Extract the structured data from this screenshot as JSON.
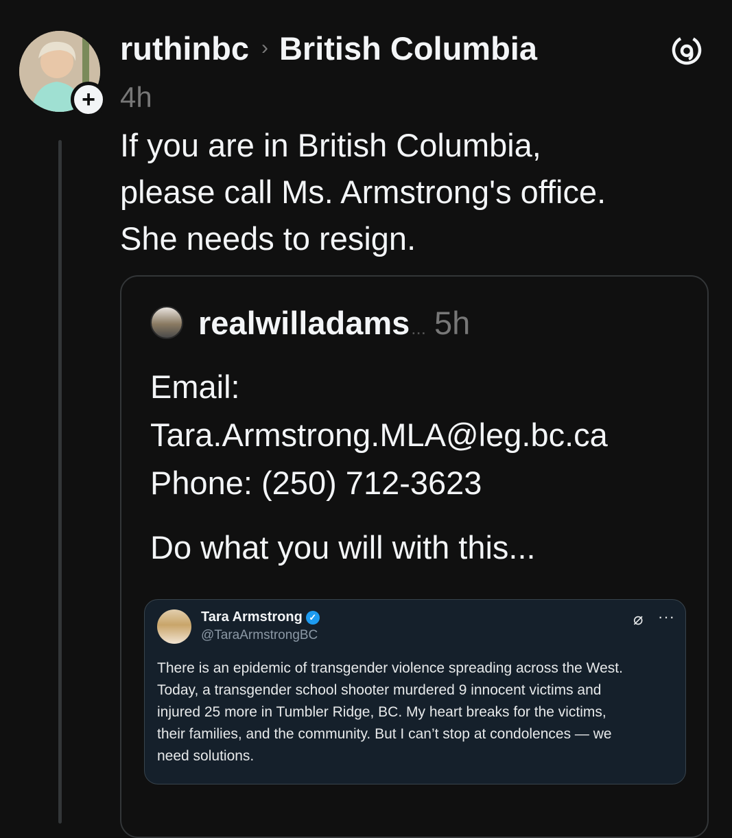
{
  "post": {
    "username": "ruthinbc",
    "separator": "›",
    "community": "British Columbia",
    "time": "4h",
    "follow_symbol": "+",
    "text_lines": [
      "If you are in British Columbia,",
      "please call Ms. Armstrong's office.",
      "She needs to resign."
    ]
  },
  "quote": {
    "username": "realwilladams",
    "ellipsis": "...",
    "time": "5h",
    "lines": [
      "Email:",
      "Tara.Armstrong.MLA@leg.bc.ca",
      "Phone: (250) 712-3623",
      "Do what you will with this..."
    ]
  },
  "tweet": {
    "name": "Tara Armstrong",
    "handle": "@TaraArmstrongBC",
    "text_lines": [
      "There is an epidemic of transgender violence spreading across the West.",
      "Today, a transgender school shooter murdered 9 innocent victims and",
      "injured 25 more in Tumbler Ridge, BC. My heart breaks for the victims,",
      "their families, and the community. But I can’t stop at condolences — we",
      "need solutions."
    ]
  },
  "icons": {
    "threads_logo": "threads-logo-icon",
    "follow": "plus-icon",
    "verified": "verified-check-icon",
    "grok": "grok-icon",
    "more": "more-icon"
  },
  "colors": {
    "background": "#101010",
    "text": "#f3f5f7",
    "muted": "#777777",
    "tweet_bg": "#15202b",
    "verified": "#1d9bf0"
  }
}
